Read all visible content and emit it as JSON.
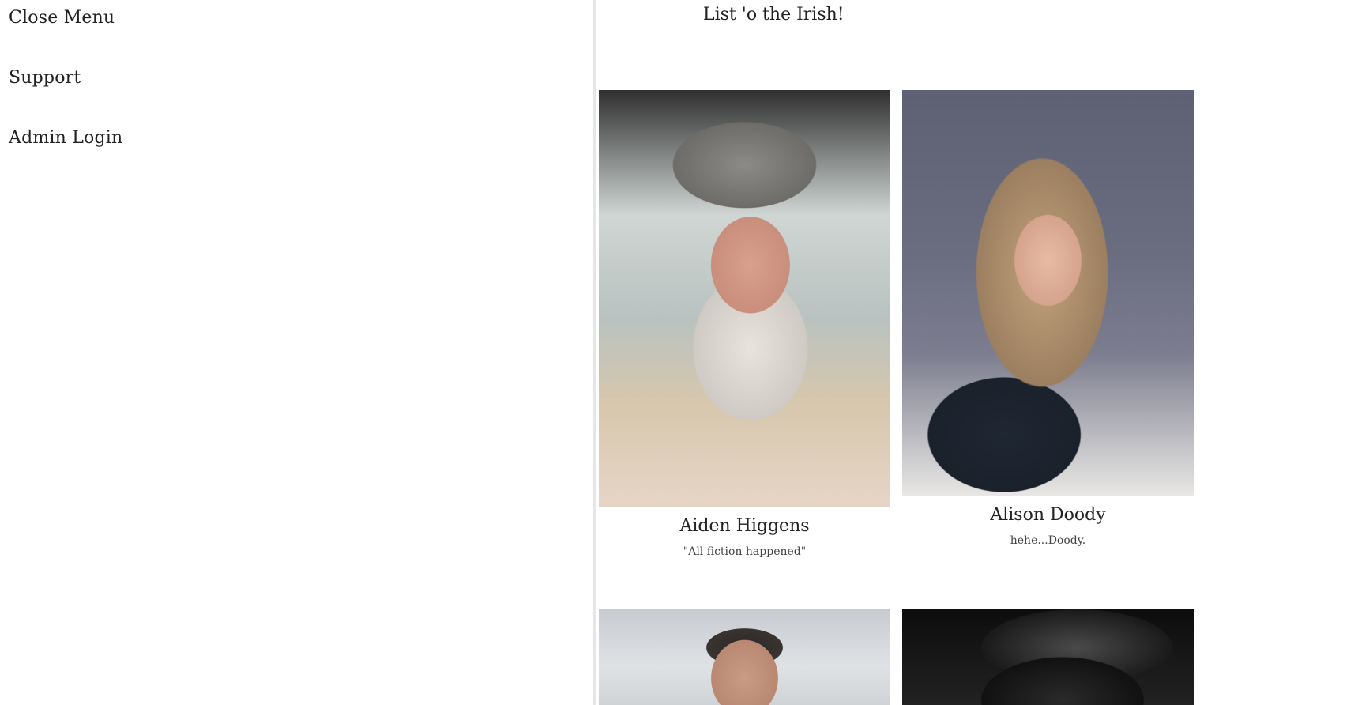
{
  "sidebar": {
    "items": [
      {
        "label": "Close Menu"
      },
      {
        "label": "Support"
      },
      {
        "label": "Admin Login"
      }
    ]
  },
  "main": {
    "title": "List 'o the Irish!",
    "cards": [
      {
        "name": "Aiden Higgens",
        "quote": "\"All fiction happened\""
      },
      {
        "name": "Alison Doody",
        "quote": "hehe...Doody."
      },
      {
        "name": "",
        "quote": ""
      },
      {
        "name": "",
        "quote": ""
      }
    ]
  }
}
